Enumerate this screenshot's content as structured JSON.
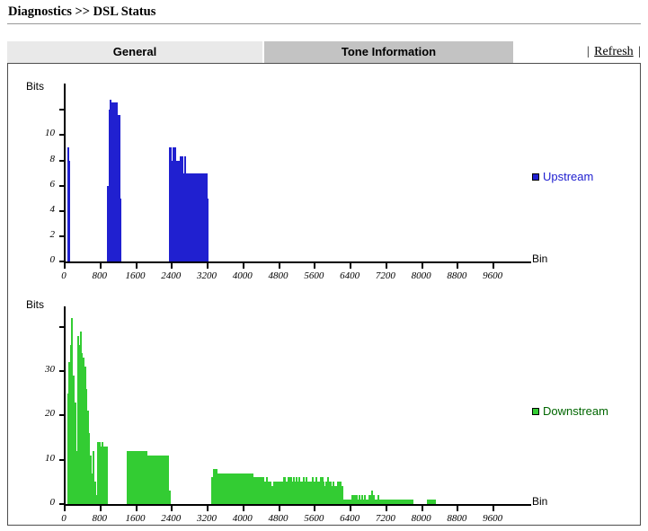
{
  "breadcrumb": "Diagnostics >> DSL Status",
  "tabs": [
    {
      "id": "general",
      "label": "General",
      "selected": false
    },
    {
      "id": "tone-information",
      "label": "Tone Information",
      "selected": true
    }
  ],
  "toolbar": {
    "left_bar": "|",
    "refresh_label": "Refresh",
    "right_bar": "|"
  },
  "colors": {
    "upstream": "#2020d0",
    "downstream": "#33cc33",
    "axis": "#000000",
    "tab_active": "#c3c3c3",
    "tab_inactive": "#e9e9e9",
    "frame_border": "#4d4d4d",
    "header_rule": "#999999"
  },
  "chart_data": [
    {
      "type": "bar",
      "id": "upstream",
      "title": "",
      "ylabel": "Bits",
      "xlabel": "Bin",
      "legend": "Upstream",
      "legend_position": "right",
      "grid": false,
      "color": "#2020d0",
      "xlim": [
        0,
        10000
      ],
      "ylim": [
        0,
        12.8
      ],
      "xticks": [
        0,
        800,
        1600,
        2400,
        3200,
        4000,
        4800,
        5600,
        6400,
        7200,
        8000,
        8800,
        9600
      ],
      "yticks": [
        0,
        2,
        4,
        6,
        8,
        10
      ],
      "ytick_labels": [
        "0",
        "2",
        "4",
        "6",
        "8",
        "10"
      ],
      "xtick_labels": [
        "0",
        "800",
        "1600",
        "2400",
        "3200",
        "4000",
        "4800",
        "5600",
        "6400",
        "7200",
        "8000",
        "8800",
        "9600"
      ],
      "bin_step": 32,
      "bars": [
        {
          "bin": 32,
          "value": 9
        },
        {
          "bin": 64,
          "value": 8
        },
        {
          "bin": 928,
          "value": 6
        },
        {
          "bin": 960,
          "value": 12
        },
        {
          "bin": 992,
          "value": 13
        },
        {
          "bin": 1024,
          "value": 12.6
        },
        {
          "bin": 1056,
          "value": 12.6
        },
        {
          "bin": 1088,
          "value": 12.6
        },
        {
          "bin": 1120,
          "value": 12.6
        },
        {
          "bin": 1152,
          "value": 11.6
        },
        {
          "bin": 1184,
          "value": 11.6
        },
        {
          "bin": 1216,
          "value": 5
        },
        {
          "bin": 2304,
          "value": 9
        },
        {
          "bin": 2336,
          "value": 9
        },
        {
          "bin": 2368,
          "value": 8
        },
        {
          "bin": 2400,
          "value": 9
        },
        {
          "bin": 2432,
          "value": 9
        },
        {
          "bin": 2464,
          "value": 8
        },
        {
          "bin": 2496,
          "value": 8
        },
        {
          "bin": 2528,
          "value": 8
        },
        {
          "bin": 2560,
          "value": 8.3
        },
        {
          "bin": 2592,
          "value": 8.3
        },
        {
          "bin": 2624,
          "value": 7
        },
        {
          "bin": 2656,
          "value": 8.3
        },
        {
          "bin": 2688,
          "value": 7
        },
        {
          "bin": 2720,
          "value": 7
        },
        {
          "bin": 2752,
          "value": 7
        },
        {
          "bin": 2784,
          "value": 7
        },
        {
          "bin": 2816,
          "value": 7
        },
        {
          "bin": 2848,
          "value": 7
        },
        {
          "bin": 2880,
          "value": 7
        },
        {
          "bin": 2912,
          "value": 7
        },
        {
          "bin": 2944,
          "value": 7
        },
        {
          "bin": 2976,
          "value": 7
        },
        {
          "bin": 3008,
          "value": 7
        },
        {
          "bin": 3040,
          "value": 7
        },
        {
          "bin": 3072,
          "value": 7
        },
        {
          "bin": 3104,
          "value": 7
        },
        {
          "bin": 3136,
          "value": 7
        },
        {
          "bin": 3168,
          "value": 5
        }
      ]
    },
    {
      "type": "bar",
      "id": "downstream",
      "title": "",
      "ylabel": "Bits",
      "xlabel": "Bin",
      "legend": "Downstream",
      "legend_position": "right",
      "grid": false,
      "color": "#33cc33",
      "xlim": [
        0,
        10000
      ],
      "ylim": [
        0,
        43
      ],
      "xticks": [
        0,
        800,
        1600,
        2400,
        3200,
        4000,
        4800,
        5600,
        6400,
        7200,
        8000,
        8800,
        9600
      ],
      "yticks": [
        0,
        10,
        20,
        30
      ],
      "ytick_labels": [
        "0",
        "10",
        "20",
        "30"
      ],
      "xtick_labels": [
        "0",
        "800",
        "1600",
        "2400",
        "3200",
        "4000",
        "4800",
        "5600",
        "6400",
        "7200",
        "8000",
        "8800",
        "9600"
      ],
      "bin_step": 32,
      "bars": [
        {
          "bin": 32,
          "value": 25
        },
        {
          "bin": 64,
          "value": 32
        },
        {
          "bin": 96,
          "value": 36
        },
        {
          "bin": 128,
          "value": 42
        },
        {
          "bin": 160,
          "value": 29
        },
        {
          "bin": 192,
          "value": 23
        },
        {
          "bin": 224,
          "value": 12
        },
        {
          "bin": 256,
          "value": 38
        },
        {
          "bin": 288,
          "value": 36
        },
        {
          "bin": 320,
          "value": 39
        },
        {
          "bin": 352,
          "value": 34
        },
        {
          "bin": 384,
          "value": 33
        },
        {
          "bin": 416,
          "value": 31
        },
        {
          "bin": 448,
          "value": 26
        },
        {
          "bin": 480,
          "value": 21
        },
        {
          "bin": 512,
          "value": 16
        },
        {
          "bin": 544,
          "value": 11
        },
        {
          "bin": 576,
          "value": 7
        },
        {
          "bin": 608,
          "value": 12
        },
        {
          "bin": 640,
          "value": 5
        },
        {
          "bin": 672,
          "value": 2
        },
        {
          "bin": 704,
          "value": 14
        },
        {
          "bin": 736,
          "value": 14
        },
        {
          "bin": 768,
          "value": 13
        },
        {
          "bin": 800,
          "value": 14
        },
        {
          "bin": 832,
          "value": 13
        },
        {
          "bin": 864,
          "value": 13
        },
        {
          "bin": 896,
          "value": 13
        },
        {
          "bin": 1376,
          "value": 12
        },
        {
          "bin": 1408,
          "value": 12
        },
        {
          "bin": 1440,
          "value": 12
        },
        {
          "bin": 1472,
          "value": 12
        },
        {
          "bin": 1504,
          "value": 12
        },
        {
          "bin": 1536,
          "value": 12
        },
        {
          "bin": 1568,
          "value": 12
        },
        {
          "bin": 1600,
          "value": 12
        },
        {
          "bin": 1632,
          "value": 12
        },
        {
          "bin": 1664,
          "value": 12
        },
        {
          "bin": 1696,
          "value": 12
        },
        {
          "bin": 1728,
          "value": 12
        },
        {
          "bin": 1760,
          "value": 12
        },
        {
          "bin": 1792,
          "value": 12
        },
        {
          "bin": 1824,
          "value": 11
        },
        {
          "bin": 1856,
          "value": 11
        },
        {
          "bin": 1888,
          "value": 11
        },
        {
          "bin": 1920,
          "value": 11
        },
        {
          "bin": 1952,
          "value": 11
        },
        {
          "bin": 1984,
          "value": 11
        },
        {
          "bin": 2016,
          "value": 11
        },
        {
          "bin": 2048,
          "value": 11
        },
        {
          "bin": 2080,
          "value": 11
        },
        {
          "bin": 2112,
          "value": 11
        },
        {
          "bin": 2144,
          "value": 11
        },
        {
          "bin": 2176,
          "value": 11
        },
        {
          "bin": 2208,
          "value": 11
        },
        {
          "bin": 2240,
          "value": 11
        },
        {
          "bin": 2272,
          "value": 11
        },
        {
          "bin": 2304,
          "value": 3
        },
        {
          "bin": 3264,
          "value": 6
        },
        {
          "bin": 3296,
          "value": 8
        },
        {
          "bin": 3328,
          "value": 8
        },
        {
          "bin": 3360,
          "value": 8
        },
        {
          "bin": 3392,
          "value": 7
        },
        {
          "bin": 3424,
          "value": 7
        },
        {
          "bin": 3456,
          "value": 7
        },
        {
          "bin": 3488,
          "value": 7
        },
        {
          "bin": 3520,
          "value": 7
        },
        {
          "bin": 3552,
          "value": 7
        },
        {
          "bin": 3584,
          "value": 7
        },
        {
          "bin": 3616,
          "value": 7
        },
        {
          "bin": 3648,
          "value": 7
        },
        {
          "bin": 3680,
          "value": 7
        },
        {
          "bin": 3712,
          "value": 7
        },
        {
          "bin": 3744,
          "value": 7
        },
        {
          "bin": 3776,
          "value": 7
        },
        {
          "bin": 3808,
          "value": 7
        },
        {
          "bin": 3840,
          "value": 7
        },
        {
          "bin": 3872,
          "value": 7
        },
        {
          "bin": 3904,
          "value": 7
        },
        {
          "bin": 3936,
          "value": 7
        },
        {
          "bin": 3968,
          "value": 7
        },
        {
          "bin": 4000,
          "value": 7
        },
        {
          "bin": 4032,
          "value": 7
        },
        {
          "bin": 4064,
          "value": 7
        },
        {
          "bin": 4096,
          "value": 7
        },
        {
          "bin": 4128,
          "value": 7
        },
        {
          "bin": 4160,
          "value": 7
        },
        {
          "bin": 4192,
          "value": 6
        },
        {
          "bin": 4224,
          "value": 6
        },
        {
          "bin": 4256,
          "value": 6
        },
        {
          "bin": 4288,
          "value": 6
        },
        {
          "bin": 4320,
          "value": 6
        },
        {
          "bin": 4352,
          "value": 6
        },
        {
          "bin": 4384,
          "value": 6
        },
        {
          "bin": 4416,
          "value": 6
        },
        {
          "bin": 4448,
          "value": 5
        },
        {
          "bin": 4480,
          "value": 6
        },
        {
          "bin": 4512,
          "value": 5
        },
        {
          "bin": 4544,
          "value": 5
        },
        {
          "bin": 4576,
          "value": 5
        },
        {
          "bin": 4608,
          "value": 4
        },
        {
          "bin": 4640,
          "value": 5
        },
        {
          "bin": 4672,
          "value": 5
        },
        {
          "bin": 4704,
          "value": 5
        },
        {
          "bin": 4736,
          "value": 5
        },
        {
          "bin": 4768,
          "value": 5
        },
        {
          "bin": 4800,
          "value": 5
        },
        {
          "bin": 4832,
          "value": 5
        },
        {
          "bin": 4864,
          "value": 6
        },
        {
          "bin": 4896,
          "value": 6
        },
        {
          "bin": 4928,
          "value": 5
        },
        {
          "bin": 4960,
          "value": 6
        },
        {
          "bin": 4992,
          "value": 6
        },
        {
          "bin": 5024,
          "value": 6
        },
        {
          "bin": 5056,
          "value": 5
        },
        {
          "bin": 5088,
          "value": 6
        },
        {
          "bin": 5120,
          "value": 5
        },
        {
          "bin": 5152,
          "value": 6
        },
        {
          "bin": 5184,
          "value": 5
        },
        {
          "bin": 5216,
          "value": 6
        },
        {
          "bin": 5248,
          "value": 5
        },
        {
          "bin": 5280,
          "value": 5
        },
        {
          "bin": 5312,
          "value": 6
        },
        {
          "bin": 5344,
          "value": 5
        },
        {
          "bin": 5376,
          "value": 6
        },
        {
          "bin": 5408,
          "value": 5
        },
        {
          "bin": 5440,
          "value": 5
        },
        {
          "bin": 5472,
          "value": 5
        },
        {
          "bin": 5504,
          "value": 6
        },
        {
          "bin": 5536,
          "value": 5
        },
        {
          "bin": 5568,
          "value": 5
        },
        {
          "bin": 5600,
          "value": 6
        },
        {
          "bin": 5632,
          "value": 5
        },
        {
          "bin": 5664,
          "value": 5
        },
        {
          "bin": 5696,
          "value": 6
        },
        {
          "bin": 5728,
          "value": 6
        },
        {
          "bin": 5760,
          "value": 5
        },
        {
          "bin": 5792,
          "value": 4
        },
        {
          "bin": 5824,
          "value": 5
        },
        {
          "bin": 5856,
          "value": 6
        },
        {
          "bin": 5888,
          "value": 5
        },
        {
          "bin": 5920,
          "value": 5
        },
        {
          "bin": 5952,
          "value": 4
        },
        {
          "bin": 5984,
          "value": 5
        },
        {
          "bin": 6016,
          "value": 4
        },
        {
          "bin": 6048,
          "value": 4
        },
        {
          "bin": 6080,
          "value": 5
        },
        {
          "bin": 6112,
          "value": 5
        },
        {
          "bin": 6144,
          "value": 5
        },
        {
          "bin": 6176,
          "value": 4
        },
        {
          "bin": 6208,
          "value": 1
        },
        {
          "bin": 6240,
          "value": 1
        },
        {
          "bin": 6272,
          "value": 1
        },
        {
          "bin": 6304,
          "value": 1
        },
        {
          "bin": 6336,
          "value": 1
        },
        {
          "bin": 6368,
          "value": 1
        },
        {
          "bin": 6400,
          "value": 2
        },
        {
          "bin": 6432,
          "value": 2
        },
        {
          "bin": 6464,
          "value": 2
        },
        {
          "bin": 6496,
          "value": 2
        },
        {
          "bin": 6528,
          "value": 1
        },
        {
          "bin": 6560,
          "value": 2
        },
        {
          "bin": 6592,
          "value": 1
        },
        {
          "bin": 6624,
          "value": 2
        },
        {
          "bin": 6656,
          "value": 1
        },
        {
          "bin": 6688,
          "value": 2
        },
        {
          "bin": 6720,
          "value": 1
        },
        {
          "bin": 6752,
          "value": 1
        },
        {
          "bin": 6784,
          "value": 2
        },
        {
          "bin": 6816,
          "value": 2
        },
        {
          "bin": 6848,
          "value": 3
        },
        {
          "bin": 6880,
          "value": 2
        },
        {
          "bin": 6912,
          "value": 1
        },
        {
          "bin": 6944,
          "value": 1
        },
        {
          "bin": 6976,
          "value": 2
        },
        {
          "bin": 7008,
          "value": 1
        },
        {
          "bin": 7040,
          "value": 1
        },
        {
          "bin": 7072,
          "value": 1
        },
        {
          "bin": 7104,
          "value": 1
        },
        {
          "bin": 7136,
          "value": 1
        },
        {
          "bin": 7168,
          "value": 1
        },
        {
          "bin": 7200,
          "value": 1
        },
        {
          "bin": 7232,
          "value": 1
        },
        {
          "bin": 7264,
          "value": 1
        },
        {
          "bin": 7296,
          "value": 1
        },
        {
          "bin": 7328,
          "value": 1
        },
        {
          "bin": 7360,
          "value": 1
        },
        {
          "bin": 7392,
          "value": 1
        },
        {
          "bin": 7424,
          "value": 1
        },
        {
          "bin": 7456,
          "value": 1
        },
        {
          "bin": 7488,
          "value": 1
        },
        {
          "bin": 7520,
          "value": 1
        },
        {
          "bin": 7552,
          "value": 1
        },
        {
          "bin": 7584,
          "value": 1
        },
        {
          "bin": 7616,
          "value": 1
        },
        {
          "bin": 7648,
          "value": 1
        },
        {
          "bin": 7680,
          "value": 1
        },
        {
          "bin": 7712,
          "value": 1
        },
        {
          "bin": 7744,
          "value": 1
        },
        {
          "bin": 8096,
          "value": 1
        },
        {
          "bin": 8128,
          "value": 1
        },
        {
          "bin": 8160,
          "value": 1
        },
        {
          "bin": 8192,
          "value": 1
        },
        {
          "bin": 8224,
          "value": 1
        },
        {
          "bin": 8256,
          "value": 1
        }
      ]
    }
  ]
}
